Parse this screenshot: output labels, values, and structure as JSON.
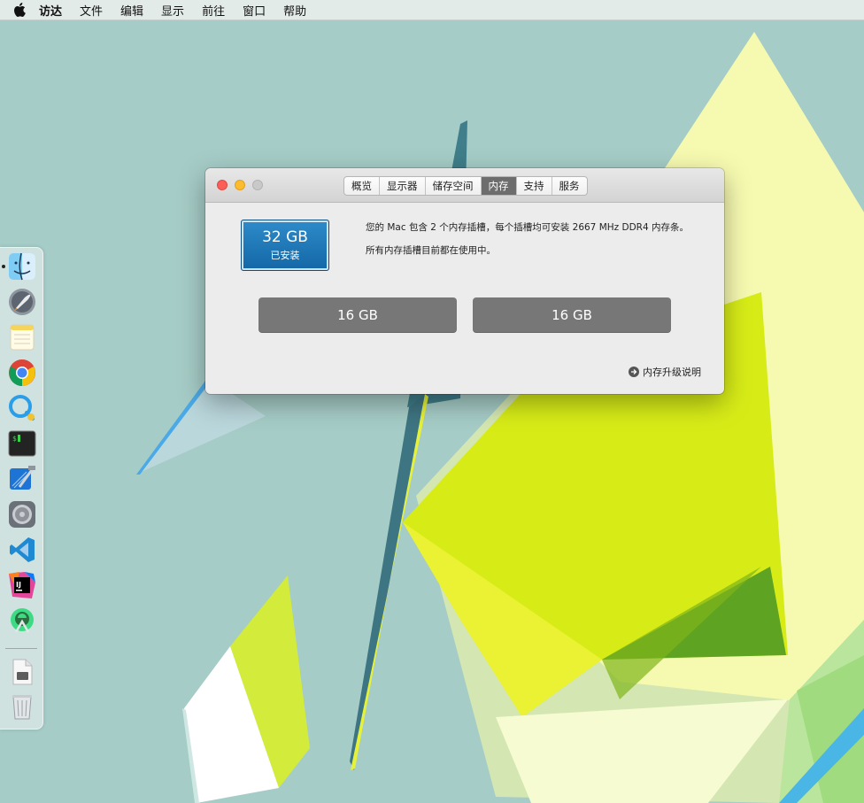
{
  "menubar": {
    "apple_icon": "apple-logo",
    "items": [
      "访达",
      "文件",
      "编辑",
      "显示",
      "前往",
      "窗口",
      "帮助"
    ]
  },
  "window": {
    "tabs": [
      "概览",
      "显示器",
      "储存空间",
      "内存",
      "支持",
      "服务"
    ],
    "active_tab": "内存",
    "memory": {
      "total": "32 GB",
      "status": "已安装",
      "description_line1": "您的 Mac 包含 2 个内存插槽，每个插槽均可安装 2667 MHz DDR4 内存条。",
      "description_line2": "所有内存插槽目前都在使用中。",
      "slots": [
        "16 GB",
        "16 GB"
      ],
      "upgrade_link": "内存升级说明"
    }
  },
  "dock": {
    "apps": [
      "finder-icon",
      "launchpad-icon",
      "notes-icon",
      "chrome-icon",
      "quicktime-icon",
      "terminal-icon",
      "xcode-icon",
      "system-preferences-icon",
      "vscode-icon",
      "intellij-idea-icon",
      "android-studio-icon",
      "document-icon",
      "trash-icon"
    ]
  },
  "colors": {
    "desktop": "#a6ccc7",
    "memory_badge": "#1f78b8",
    "slot": "#777777"
  }
}
